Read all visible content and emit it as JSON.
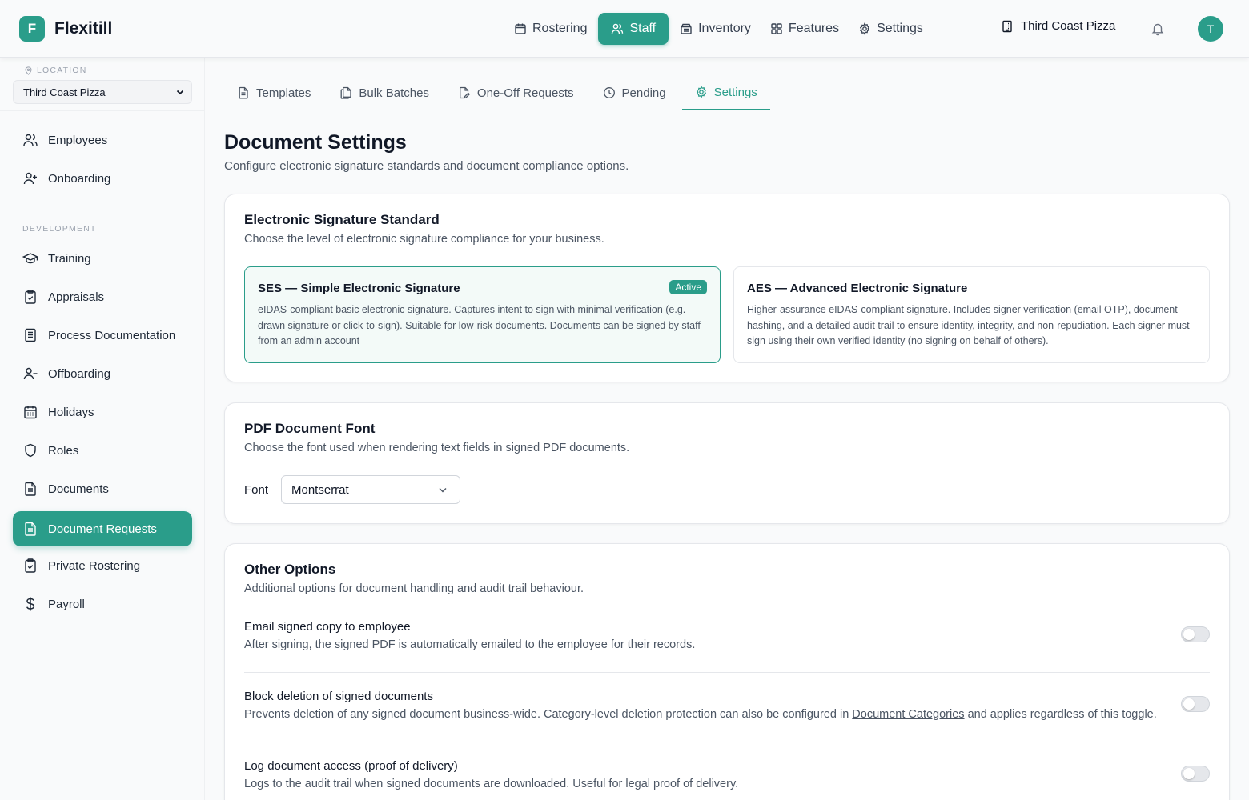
{
  "app": {
    "logo_letter": "F",
    "name": "Flexitill"
  },
  "topnav": {
    "items": [
      {
        "label": "Rostering",
        "icon": "calendar-icon"
      },
      {
        "label": "Staff",
        "icon": "users-icon",
        "active": true
      },
      {
        "label": "Inventory",
        "icon": "archive-icon"
      },
      {
        "label": "Features",
        "icon": "grid-icon"
      },
      {
        "label": "Settings",
        "icon": "gear-icon"
      }
    ],
    "location": "Third Coast Pizza",
    "avatar_initial": "T"
  },
  "sidebar": {
    "location_label": "LOCATION",
    "location_value": "Third Coast Pizza",
    "items": [
      {
        "label": "Employees",
        "icon": "users-icon"
      },
      {
        "label": "Onboarding",
        "icon": "user-plus-icon"
      }
    ],
    "section_label": "DEVELOPMENT",
    "dev_items": [
      {
        "label": "Training",
        "icon": "graduation-cap-icon"
      },
      {
        "label": "Appraisals",
        "icon": "clipboard-check-icon"
      },
      {
        "label": "Process Documentation",
        "icon": "document-list-icon"
      },
      {
        "label": "Offboarding",
        "icon": "user-minus-icon"
      },
      {
        "label": "Holidays",
        "icon": "calendar-days-icon"
      },
      {
        "label": "Roles",
        "icon": "shield-icon"
      },
      {
        "label": "Documents",
        "icon": "file-text-icon"
      },
      {
        "label": "Document Requests",
        "icon": "file-text-icon",
        "active": true
      },
      {
        "label": "Private Rostering",
        "icon": "clipboard-check-icon"
      },
      {
        "label": "Payroll",
        "icon": "dollar-icon"
      }
    ]
  },
  "tabs": [
    {
      "label": "Templates",
      "icon": "file-icon"
    },
    {
      "label": "Bulk Batches",
      "icon": "files-icon"
    },
    {
      "label": "One-Off Requests",
      "icon": "file-edit-icon"
    },
    {
      "label": "Pending",
      "icon": "clock-icon"
    },
    {
      "label": "Settings",
      "icon": "gear-icon",
      "active": true
    }
  ],
  "page": {
    "title": "Document Settings",
    "subtitle": "Configure electronic signature standards and document compliance options."
  },
  "signature": {
    "title": "Electronic Signature Standard",
    "description": "Choose the level of electronic signature compliance for your business.",
    "options": [
      {
        "title": "SES — Simple Electronic Signature",
        "badge": "Active",
        "description": "eIDAS-compliant basic electronic signature. Captures intent to sign with minimal verification (e.g. drawn signature or click-to-sign). Suitable for low-risk documents. Documents can be signed by staff from an admin account"
      },
      {
        "title": "AES — Advanced Electronic Signature",
        "description": "Higher-assurance eIDAS-compliant signature. Includes signer verification (email OTP), document hashing, and a detailed audit trail to ensure identity, integrity, and non-repudiation. Each signer must sign using their own verified identity (no signing on behalf of others)."
      }
    ]
  },
  "pdf_font": {
    "title": "PDF Document Font",
    "description": "Choose the font used when rendering text fields in signed PDF documents.",
    "label": "Font",
    "value": "Montserrat"
  },
  "other": {
    "title": "Other Options",
    "description": "Additional options for document handling and audit trail behaviour.",
    "rows": [
      {
        "name": "Email signed copy to employee",
        "help": "After signing, the signed PDF is automatically emailed to the employee for their records.",
        "enabled": false
      },
      {
        "name": "Block deletion of signed documents",
        "help_before": "Prevents deletion of any signed document business-wide. Category-level deletion protection can also be configured in ",
        "help_link": "Document Categories",
        "help_after": " and applies regardless of this toggle.",
        "enabled": false
      },
      {
        "name": "Log document access (proof of delivery)",
        "help": "Logs to the audit trail when signed documents are downloaded. Useful for legal proof of delivery.",
        "enabled": false
      }
    ]
  },
  "colors": {
    "accent": "#2a9d8a",
    "text": "#111827",
    "muted": "#4b5563"
  }
}
